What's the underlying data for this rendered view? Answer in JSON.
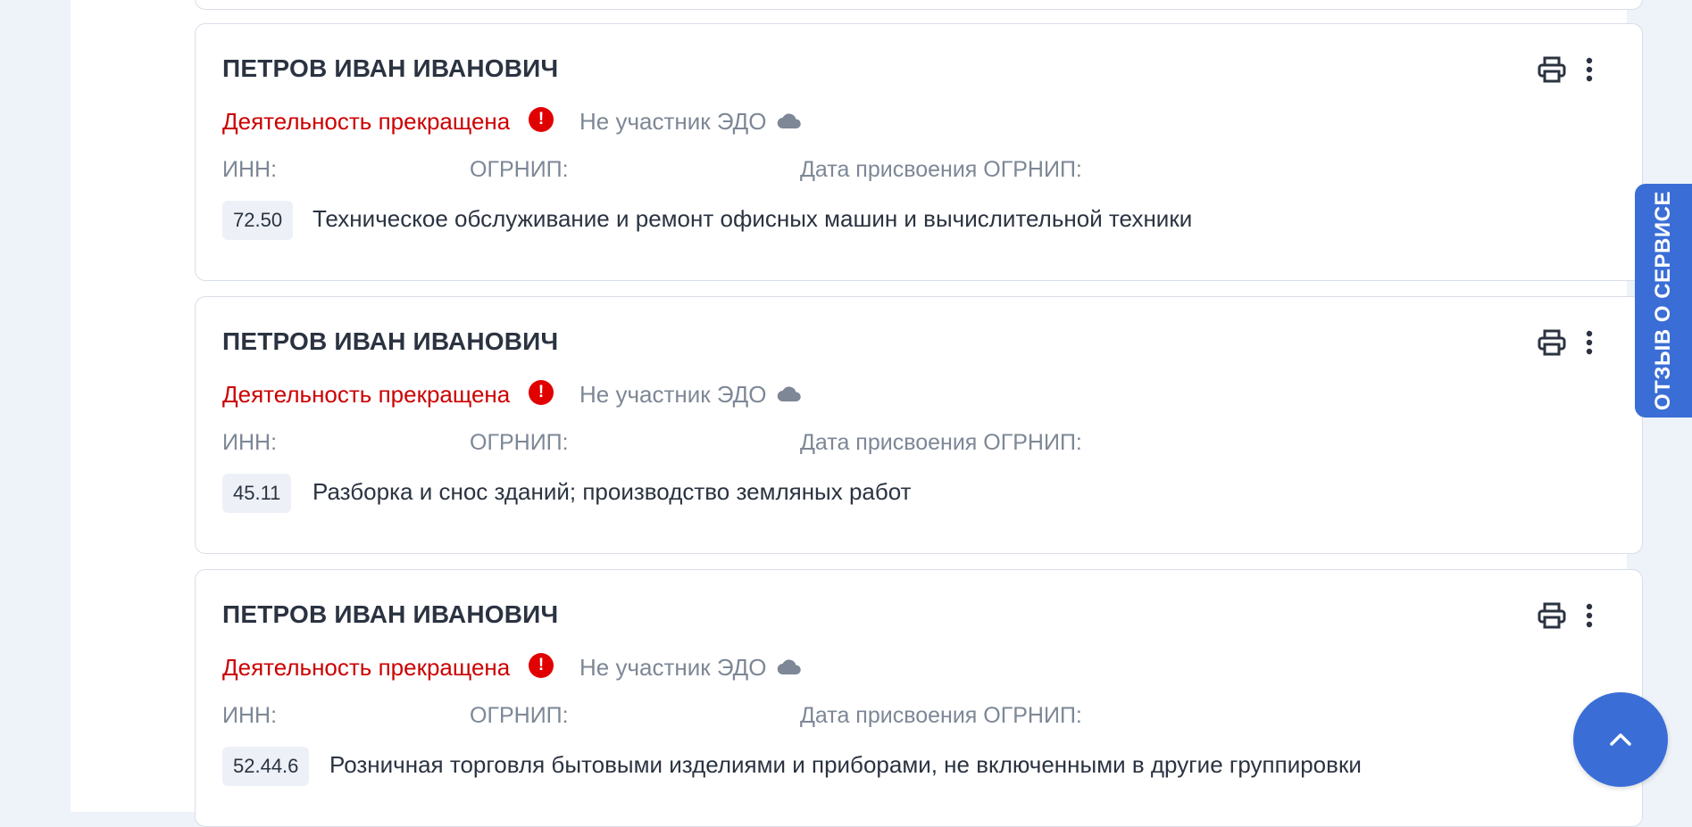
{
  "records": [
    {
      "name": "ПЕТРОВ ИВАН ИВАНОВИЧ",
      "status": "Деятельность прекращена",
      "status_icon": "!",
      "edo": "Не участник ЭДО",
      "inn_label": "ИНН:",
      "ogrnip_label": "ОГРНИП:",
      "ogrnip_date_label": "Дата присвоения ОГРНИП:",
      "okved_code": "72.50",
      "okved_text": "Техническое обслуживание и ремонт офисных машин и вычислительной техники"
    },
    {
      "name": "ПЕТРОВ ИВАН ИВАНОВИЧ",
      "status": "Деятельность прекращена",
      "status_icon": "!",
      "edo": "Не участник ЭДО",
      "inn_label": "ИНН:",
      "ogrnip_label": "ОГРНИП:",
      "ogrnip_date_label": "Дата присвоения ОГРНИП:",
      "okved_code": "45.11",
      "okved_text": "Разборка и снос зданий; производство земляных работ"
    },
    {
      "name": "ПЕТРОВ ИВАН ИВАНОВИЧ",
      "status": "Деятельность прекращена",
      "status_icon": "!",
      "edo": "Не участник ЭДО",
      "inn_label": "ИНН:",
      "ogrnip_label": "ОГРНИП:",
      "ogrnip_date_label": "Дата присвоения ОГРНИП:",
      "okved_code": "52.44.6",
      "okved_text": "Розничная торговля бытовыми изделиями и приборами, не включенными в другие группировки"
    }
  ],
  "feedback": {
    "label": "ОТЗЫВ О СЕРВИСЕ"
  },
  "icons": {
    "print": "printer-icon",
    "more": "more-vertical-icon",
    "status": "exclamation-circle-icon",
    "edo": "cloud-icon",
    "scroll_top": "chevron-up-icon"
  },
  "colors": {
    "status_red": "#cc0000",
    "accent_blue": "#3a6ed6",
    "muted_text": "#7d8796",
    "page_bg": "#eef2f9"
  }
}
